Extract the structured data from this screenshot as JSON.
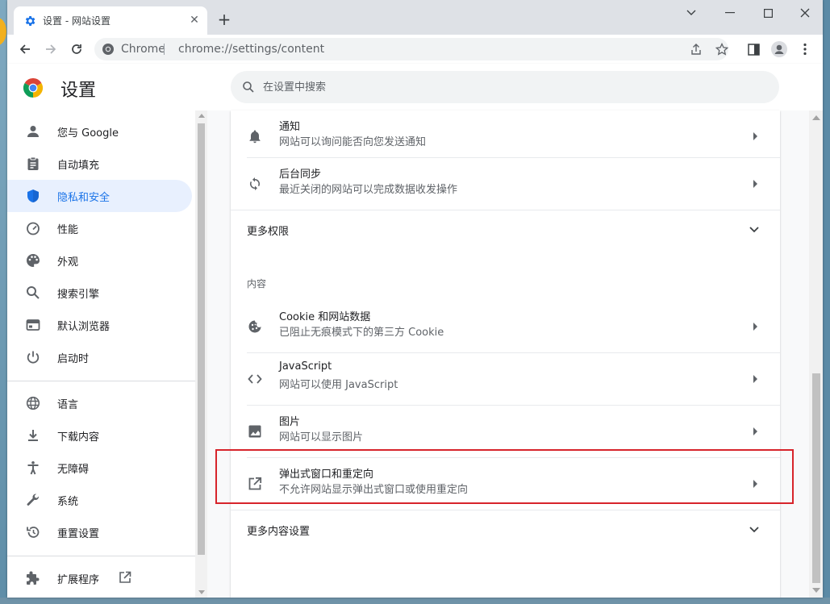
{
  "browser": {
    "tab_title": "设置 - 网站设置",
    "omnibox_site": "Chrome",
    "omnibox_url": "chrome://settings/content"
  },
  "header": {
    "title": "设置",
    "search_placeholder": "在设置中搜索"
  },
  "sidebar": {
    "items": [
      {
        "label": "您与 Google",
        "icon": "person-icon",
        "active": false
      },
      {
        "label": "自动填充",
        "icon": "clipboard-icon",
        "active": false
      },
      {
        "label": "隐私和安全",
        "icon": "shield-icon",
        "active": true
      },
      {
        "label": "性能",
        "icon": "speedometer-icon",
        "active": false
      },
      {
        "label": "外观",
        "icon": "palette-icon",
        "active": false
      },
      {
        "label": "搜索引擎",
        "icon": "search-icon",
        "active": false
      },
      {
        "label": "默认浏览器",
        "icon": "browser-icon",
        "active": false
      },
      {
        "label": "启动时",
        "icon": "power-icon",
        "active": false
      },
      {
        "label": "语言",
        "icon": "globe-icon",
        "active": false
      },
      {
        "label": "下载内容",
        "icon": "download-icon",
        "active": false
      },
      {
        "label": "无障碍",
        "icon": "accessibility-icon",
        "active": false
      },
      {
        "label": "系统",
        "icon": "wrench-icon",
        "active": false
      },
      {
        "label": "重置设置",
        "icon": "reset-icon",
        "active": false
      },
      {
        "label": "扩展程序",
        "icon": "puzzle-icon",
        "active": false
      }
    ]
  },
  "content": {
    "permissions": [
      {
        "title": "通知",
        "subtitle": "网站可以询问能否向您发送通知",
        "icon": "bell-icon"
      },
      {
        "title": "后台同步",
        "subtitle": "最近关闭的网站可以完成数据收发操作",
        "icon": "sync-icon"
      }
    ],
    "more_permissions_label": "更多权限",
    "content_section_heading": "内容",
    "content_items": [
      {
        "title": "Cookie 和网站数据",
        "subtitle": "已阻止无痕模式下的第三方 Cookie",
        "icon": "cookie-icon"
      },
      {
        "title": "JavaScript",
        "subtitle": "网站可以使用 JavaScript",
        "icon": "code-icon"
      },
      {
        "title": "图片",
        "subtitle": "网站可以显示图片",
        "icon": "image-icon"
      },
      {
        "title": "弹出式窗口和重定向",
        "subtitle": "不允许网站显示弹出式窗口或使用重定向",
        "icon": "external-link-icon"
      }
    ],
    "more_content_settings_label": "更多内容设置"
  },
  "colors": {
    "accent": "#1a73e8",
    "active_nav_bg": "#e8f0fe",
    "highlight_border": "#d7242b"
  }
}
